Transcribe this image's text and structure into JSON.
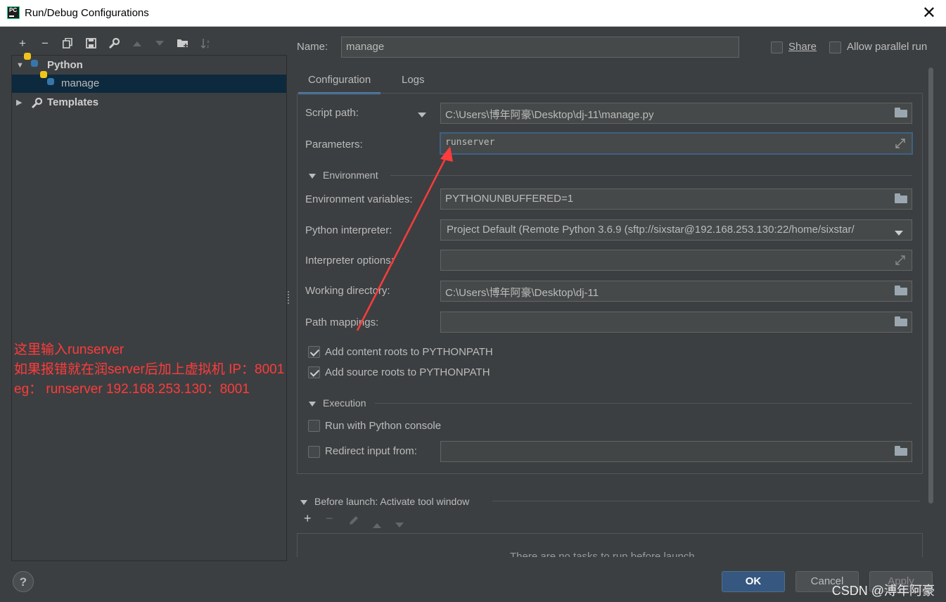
{
  "window": {
    "title": "Run/Debug Configurations",
    "app_icon_text": "PC"
  },
  "left_toolbar": {
    "icons": [
      "add-icon",
      "remove-icon",
      "copy-icon",
      "save-icon",
      "wrench-icon",
      "move-up-icon",
      "move-down-icon",
      "new-folder-icon",
      "sort-icon"
    ]
  },
  "tree": {
    "python_label": "Python",
    "manage_label": "manage",
    "templates_label": "Templates"
  },
  "annotation": {
    "line1": "这里输入runserver",
    "line2": "如果报错就在润server后加上虚拟机 IP：8001",
    "line3": "eg：  runserver 192.168.253.130：8001",
    "color": "#ff3b3b"
  },
  "header": {
    "name_label": "Name:",
    "name_value": "manage",
    "share_label": "Share",
    "allow_parallel_label": "Allow parallel run"
  },
  "tabs": [
    {
      "label": "Configuration",
      "active": true
    },
    {
      "label": "Logs",
      "active": false
    }
  ],
  "config": {
    "script_path_label": "Script path:",
    "script_path_value": "C:\\Users\\博年阿豪\\Desktop\\dj-11\\manage.py",
    "parameters_label": "Parameters:",
    "parameters_value": "runserver",
    "environment_section": "Environment",
    "env_vars_label": "Environment variables:",
    "env_vars_value": "PYTHONUNBUFFERED=1",
    "interpreter_label": "Python interpreter:",
    "interpreter_value": "Project Default (Remote Python 3.6.9 (sftp://sixstar@192.168.253.130:22/home/sixstar/",
    "interp_options_label": "Interpreter options:",
    "interp_options_value": "",
    "working_dir_label": "Working directory:",
    "working_dir_value": "C:\\Users\\博年阿豪\\Desktop\\dj-11",
    "path_mappings_label": "Path mappings:",
    "path_mappings_value": "",
    "add_content_roots_label": "Add content roots to PYTHONPATH",
    "add_content_roots_checked": true,
    "add_source_roots_label": "Add source roots to PYTHONPATH",
    "add_source_roots_checked": true,
    "execution_section": "Execution",
    "run_console_label": "Run with Python console",
    "run_console_checked": false,
    "redirect_input_label": "Redirect input from:",
    "redirect_input_checked": false,
    "redirect_input_value": ""
  },
  "before_launch": {
    "title": "Before launch: Activate tool window",
    "empty_text": "There are no tasks to run before launch"
  },
  "footer": {
    "help_label": "?",
    "ok_label": "OK",
    "cancel_label": "Cancel",
    "apply_label": "Apply",
    "watermark": "CSDN @溥年阿豪"
  },
  "colors": {
    "background": "#3c3f41",
    "selection": "#0d293e",
    "accent": "#4a88c7",
    "primary_button": "#365880"
  }
}
